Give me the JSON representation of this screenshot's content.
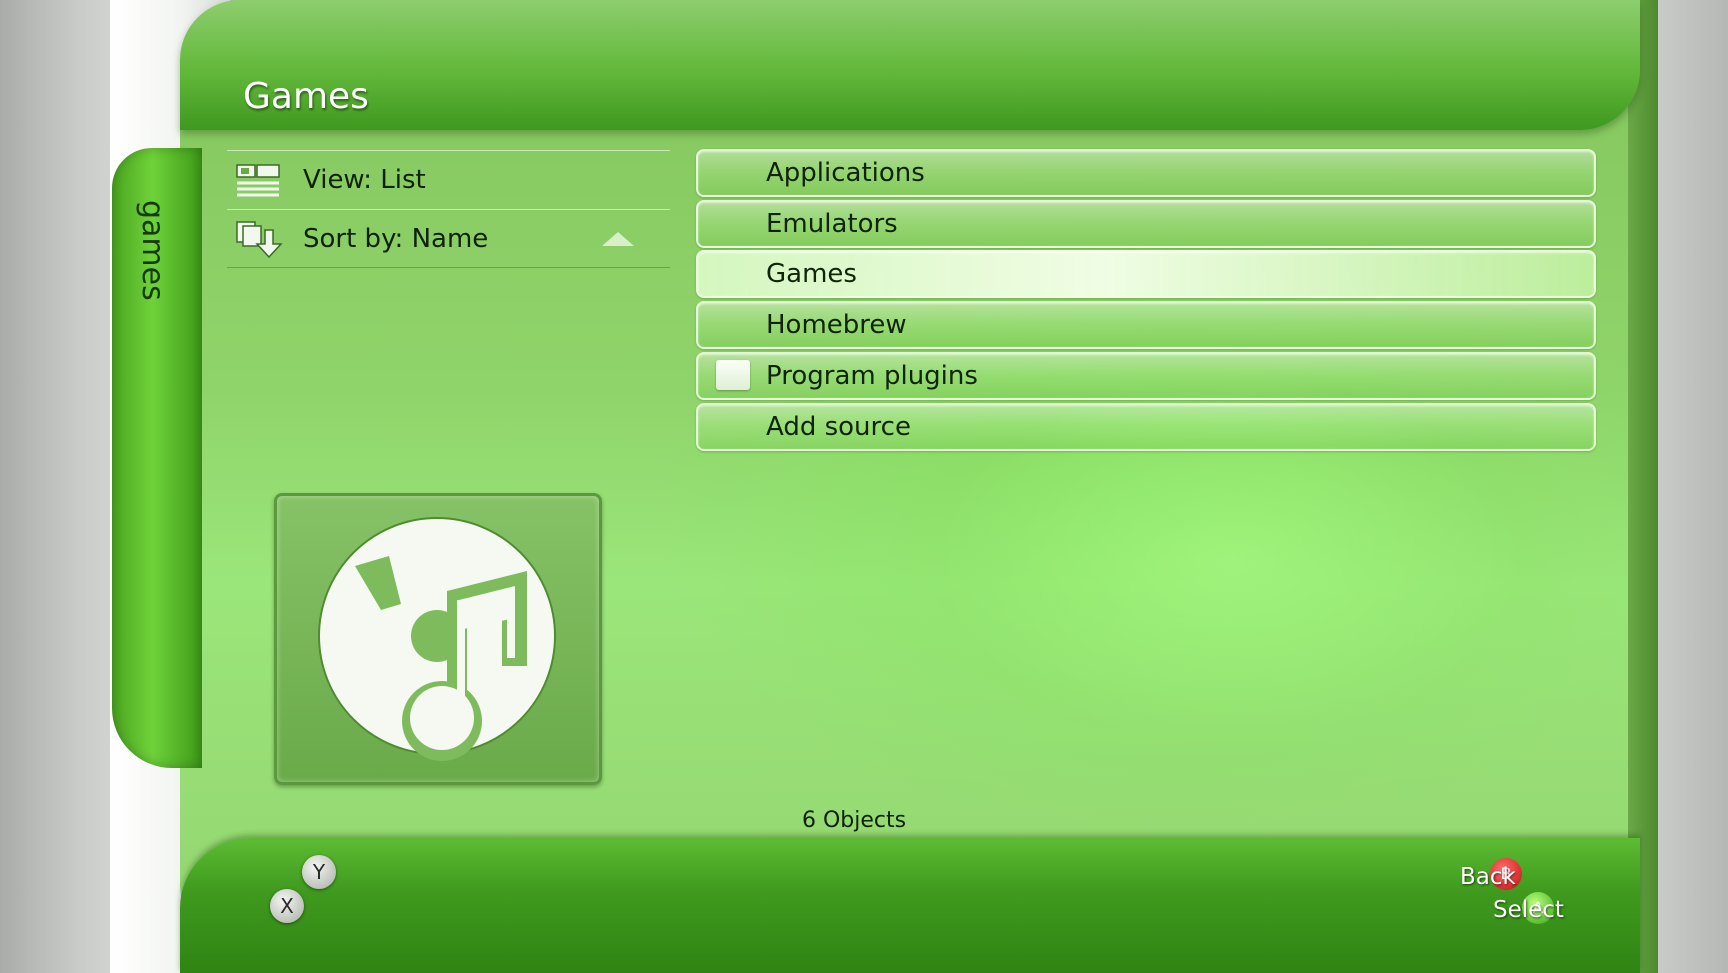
{
  "side_tab": {
    "label": "games"
  },
  "header": {
    "title": "Games"
  },
  "options": [
    {
      "label": "View: List",
      "icon": "list-view-icon"
    },
    {
      "label": "Sort by: Name",
      "icon": "sort-icon",
      "direction": "ascending"
    }
  ],
  "list": {
    "items": [
      {
        "label": "Applications",
        "icon": ""
      },
      {
        "label": "Emulators",
        "icon": ""
      },
      {
        "label": "Games",
        "icon": "",
        "selected": true
      },
      {
        "label": "Homebrew",
        "icon": ""
      },
      {
        "label": "Program plugins",
        "icon": "folder-icon"
      },
      {
        "label": "Add source",
        "icon": ""
      }
    ]
  },
  "thumbnail": {
    "icon": "music-disc-icon"
  },
  "status": {
    "count": "6 Objects"
  },
  "footer": {
    "buttons": [
      {
        "glyph": "Y",
        "color": "#b0b6ac"
      },
      {
        "glyph": "X",
        "color": "#b0b6ac"
      }
    ],
    "hints": [
      {
        "label": "Back",
        "glyph": "B",
        "color": "#d81818"
      },
      {
        "label": "Select",
        "glyph": "A",
        "color": "#47b81f"
      }
    ]
  },
  "colors": {
    "accent_green": "#62b83a",
    "panel_green": "#93d36f",
    "text_dark": "#10240a"
  }
}
